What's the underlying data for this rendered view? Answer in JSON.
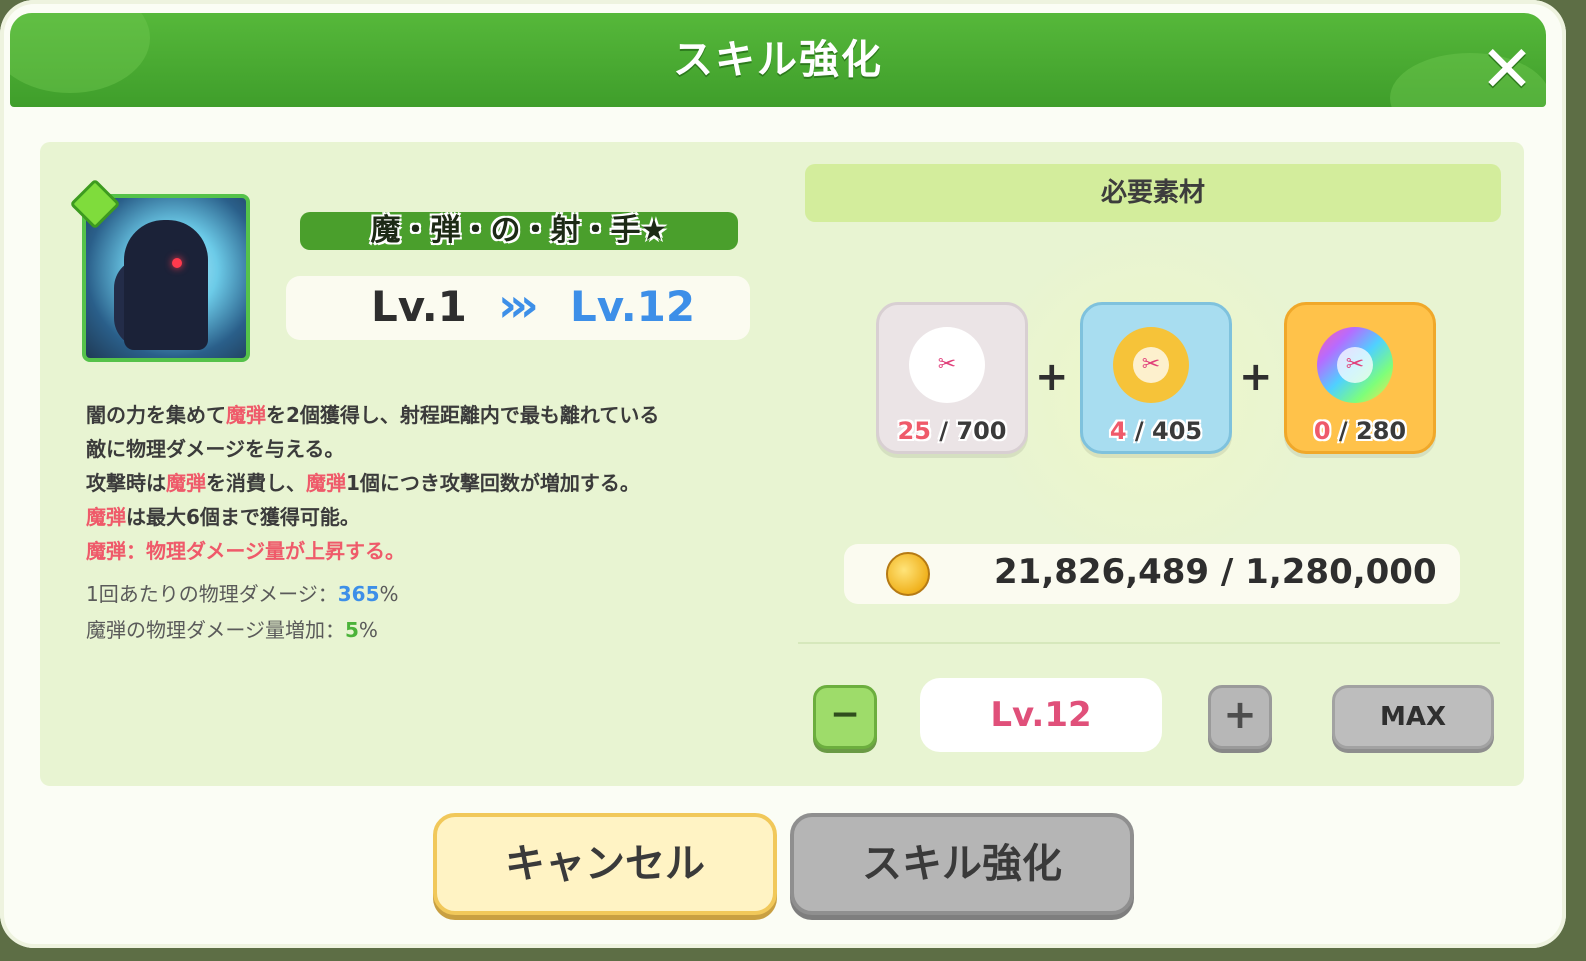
{
  "header": {
    "title": "スキル強化",
    "close_icon": "close-icon"
  },
  "skill": {
    "name": "魔・弾・の・射・手★",
    "level_from": "Lv.1",
    "level_arrow": "»",
    "level_to": "Lv.12",
    "description": {
      "line1_a": "闇の力を集めて",
      "line1_hl": "魔弾",
      "line1_b": "を2個獲得し、射程距離内で最も離れている",
      "line2": "敵に物理ダメージを与える。",
      "line3_a": "攻撃時は",
      "line3_hl1": "魔弾",
      "line3_b": "を消費し、",
      "line3_hl2": "魔弾",
      "line3_c": "1個につき攻撃回数が増加する。",
      "line4_hl": "魔弾",
      "line4_b": "は最大6個まで獲得可能。",
      "line5": "魔弾：物理ダメージ量が上昇する。"
    },
    "stats": [
      {
        "label": "1回あたりの物理ダメージ：",
        "value": "365",
        "unit": "%"
      },
      {
        "label": "魔弾の物理ダメージ量増加：",
        "value": "5",
        "unit": "%"
      }
    ]
  },
  "materials": {
    "title": "必要素材",
    "items": [
      {
        "icon": "white-skill-powder-icon",
        "have": "25",
        "sep": " / ",
        "need": "700",
        "color": "#e9e2e4"
      },
      {
        "icon": "gold-skill-powder-icon",
        "have": "4",
        "sep": " / ",
        "need": "405",
        "color": "#9fd9ef"
      },
      {
        "icon": "rainbow-skill-powder-icon",
        "have": "0",
        "sep": " / ",
        "need": "280",
        "color": "#ffc24a"
      }
    ],
    "plus": "+",
    "coin": {
      "icon": "coin-icon",
      "text": "21,826,489 / 1,280,000"
    }
  },
  "level_control": {
    "minus": "−",
    "value": "Lv.12",
    "plus": "+",
    "max": "MAX"
  },
  "footer": {
    "cancel": "キャンセル",
    "confirm": "スキル強化"
  }
}
